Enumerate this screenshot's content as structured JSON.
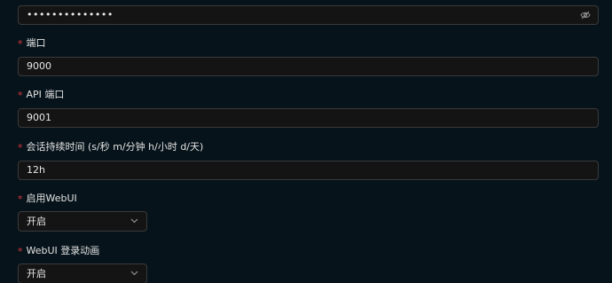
{
  "password": {
    "value": "••••••••••••••",
    "toggle_icon": "eye-slash-icon"
  },
  "fields": [
    {
      "label": "端口",
      "value": "9000"
    },
    {
      "label": "API 端口",
      "value": "9001"
    },
    {
      "label": "会话持续时间 (s/秒 m/分钟 h/小时 d/天)",
      "value": "12h"
    }
  ],
  "selects": [
    {
      "label": "启用WebUI",
      "value": "开启"
    },
    {
      "label": "WebUI 登录动画",
      "value": "开启"
    }
  ],
  "required_mark": "*",
  "colors": {
    "background": "#06131a",
    "input_bg": "#141414",
    "border": "#3a3a3a",
    "required": "#d9363e",
    "text": "#e6e6e6"
  }
}
